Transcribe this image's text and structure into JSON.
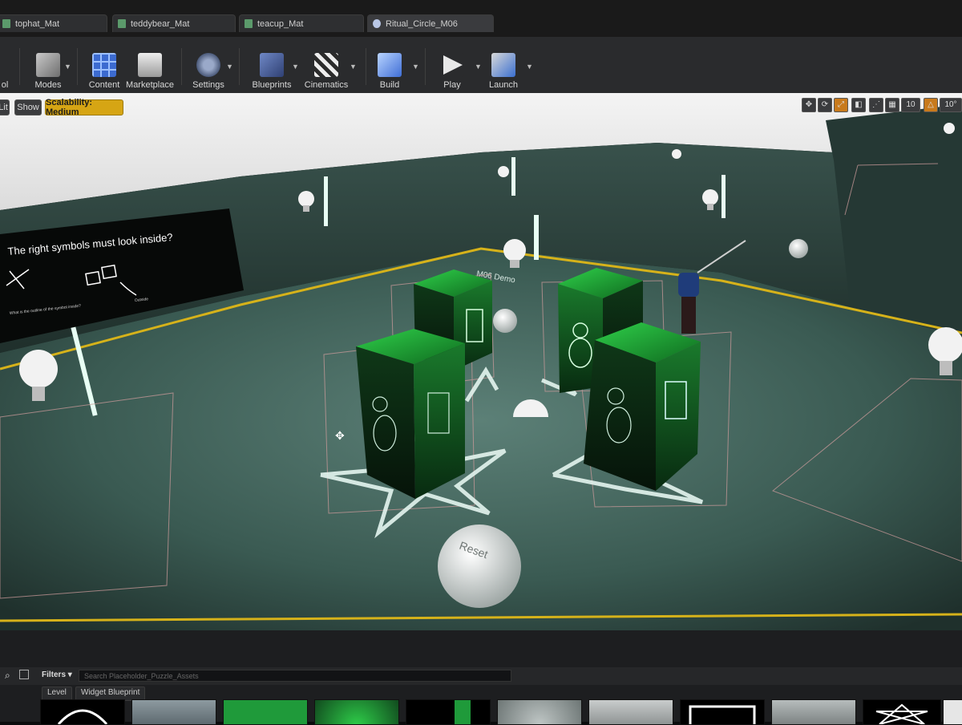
{
  "tabs": [
    {
      "label": "tophat_Mat",
      "active": false
    },
    {
      "label": "teddybear_Mat",
      "active": false
    },
    {
      "label": "teacup_Mat",
      "active": false
    },
    {
      "label": "Ritual_Circle_M06",
      "active": true
    }
  ],
  "toolbar": {
    "partial_left_label": "ol",
    "modes_label": "Modes",
    "content_label": "Content",
    "marketplace_label": "Marketplace",
    "settings_label": "Settings",
    "blueprints_label": "Blueprints",
    "cinematics_label": "Cinematics",
    "build_label": "Build",
    "play_label": "Play",
    "launch_label": "Launch"
  },
  "viewport_bar": {
    "lit_label": "Lit",
    "show_label": "Show",
    "scalability_label": "Scalability: Medium",
    "grid_snap_value": "10",
    "rotation_snap_value": "10°"
  },
  "scene": {
    "sign_text": "The right symbols must look inside?",
    "sign_caption_left": "What is the outline of the symbol inside?",
    "sign_caption_right": "Outside",
    "floor_text": "M06 Demo",
    "reset_text": "Reset"
  },
  "content_browser": {
    "filters_label": "Filters",
    "search_placeholder": "Search Placeholder_Puzzle_Assets",
    "tag_level": "Level",
    "tag_widget": "Widget Blueprint"
  },
  "colors": {
    "floor": "#38564f",
    "wall": "#2c403b",
    "block_green": "#1c8c2e",
    "accent_yellow": "#d6b21a"
  }
}
